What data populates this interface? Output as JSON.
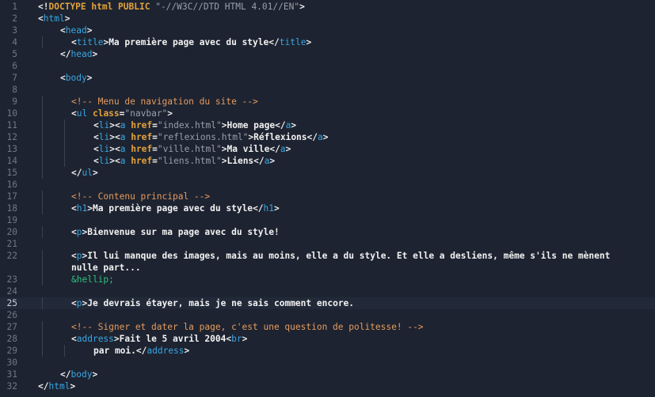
{
  "editor": {
    "current_line": 25,
    "lines": [
      {
        "n": "1",
        "indent": 0,
        "tokens": [
          [
            "punct",
            "<!"
          ],
          [
            "doctype",
            "DOCTYPE html PUBLIC "
          ],
          [
            "str",
            "\"-//W3C//DTD HTML 4.01//EN\""
          ],
          [
            "punct",
            ">"
          ]
        ]
      },
      {
        "n": "2",
        "indent": 0,
        "tokens": [
          [
            "punct",
            "<"
          ],
          [
            "tag",
            "html"
          ],
          [
            "punct",
            ">"
          ]
        ]
      },
      {
        "n": "3",
        "indent": 1,
        "tokens": [
          [
            "punct",
            "<"
          ],
          [
            "tag",
            "head"
          ],
          [
            "punct",
            ">"
          ]
        ]
      },
      {
        "n": "4",
        "indent": 2,
        "tokens": [
          [
            "punct",
            "<"
          ],
          [
            "tag",
            "title"
          ],
          [
            "punct",
            ">"
          ],
          [
            "text",
            "Ma première page avec du style"
          ],
          [
            "punct",
            "</"
          ],
          [
            "tag",
            "title"
          ],
          [
            "punct",
            ">"
          ]
        ]
      },
      {
        "n": "5",
        "indent": 1,
        "tokens": [
          [
            "punct",
            "</"
          ],
          [
            "tag",
            "head"
          ],
          [
            "punct",
            ">"
          ]
        ]
      },
      {
        "n": "6",
        "indent": 0,
        "tokens": []
      },
      {
        "n": "7",
        "indent": 1,
        "tokens": [
          [
            "punct",
            "<"
          ],
          [
            "tag",
            "body"
          ],
          [
            "punct",
            ">"
          ]
        ]
      },
      {
        "n": "8",
        "indent": 0,
        "tokens": []
      },
      {
        "n": "9",
        "indent": 2,
        "tokens": [
          [
            "comment",
            "<!-- Menu de navigation du site -->"
          ]
        ]
      },
      {
        "n": "10",
        "indent": 2,
        "tokens": [
          [
            "punct",
            "<"
          ],
          [
            "tag",
            "ul "
          ],
          [
            "attr",
            "class"
          ],
          [
            "punct",
            "="
          ],
          [
            "str",
            "\"navbar\""
          ],
          [
            "punct",
            ">"
          ]
        ]
      },
      {
        "n": "11",
        "indent": 3,
        "tokens": [
          [
            "punct",
            "<"
          ],
          [
            "tag",
            "li"
          ],
          [
            "punct",
            "><"
          ],
          [
            "tag",
            "a "
          ],
          [
            "attr",
            "href"
          ],
          [
            "punct",
            "="
          ],
          [
            "str",
            "\"index.html\""
          ],
          [
            "punct",
            ">"
          ],
          [
            "text",
            "Home page"
          ],
          [
            "punct",
            "</"
          ],
          [
            "tag",
            "a"
          ],
          [
            "punct",
            ">"
          ]
        ]
      },
      {
        "n": "12",
        "indent": 3,
        "tokens": [
          [
            "punct",
            "<"
          ],
          [
            "tag",
            "li"
          ],
          [
            "punct",
            "><"
          ],
          [
            "tag",
            "a "
          ],
          [
            "attr",
            "href"
          ],
          [
            "punct",
            "="
          ],
          [
            "str",
            "\"reflexions.html\""
          ],
          [
            "punct",
            ">"
          ],
          [
            "text",
            "Réflexions"
          ],
          [
            "punct",
            "</"
          ],
          [
            "tag",
            "a"
          ],
          [
            "punct",
            ">"
          ]
        ]
      },
      {
        "n": "13",
        "indent": 3,
        "tokens": [
          [
            "punct",
            "<"
          ],
          [
            "tag",
            "li"
          ],
          [
            "punct",
            "><"
          ],
          [
            "tag",
            "a "
          ],
          [
            "attr",
            "href"
          ],
          [
            "punct",
            "="
          ],
          [
            "str",
            "\"ville.html\""
          ],
          [
            "punct",
            ">"
          ],
          [
            "text",
            "Ma ville"
          ],
          [
            "punct",
            "</"
          ],
          [
            "tag",
            "a"
          ],
          [
            "punct",
            ">"
          ]
        ]
      },
      {
        "n": "14",
        "indent": 3,
        "tokens": [
          [
            "punct",
            "<"
          ],
          [
            "tag",
            "li"
          ],
          [
            "punct",
            "><"
          ],
          [
            "tag",
            "a "
          ],
          [
            "attr",
            "href"
          ],
          [
            "punct",
            "="
          ],
          [
            "str",
            "\"liens.html\""
          ],
          [
            "punct",
            ">"
          ],
          [
            "text",
            "Liens"
          ],
          [
            "punct",
            "</"
          ],
          [
            "tag",
            "a"
          ],
          [
            "punct",
            ">"
          ]
        ]
      },
      {
        "n": "15",
        "indent": 2,
        "tokens": [
          [
            "punct",
            "</"
          ],
          [
            "tag",
            "ul"
          ],
          [
            "punct",
            ">"
          ]
        ]
      },
      {
        "n": "16",
        "indent": 0,
        "tokens": []
      },
      {
        "n": "17",
        "indent": 2,
        "tokens": [
          [
            "comment",
            "<!-- Contenu principal -->"
          ]
        ]
      },
      {
        "n": "18",
        "indent": 2,
        "tokens": [
          [
            "punct",
            "<"
          ],
          [
            "tag",
            "h1"
          ],
          [
            "punct",
            ">"
          ],
          [
            "text",
            "Ma première page avec du style"
          ],
          [
            "punct",
            "</"
          ],
          [
            "tag",
            "h1"
          ],
          [
            "punct",
            ">"
          ]
        ]
      },
      {
        "n": "19",
        "indent": 0,
        "tokens": []
      },
      {
        "n": "20",
        "indent": 2,
        "tokens": [
          [
            "punct",
            "<"
          ],
          [
            "tag",
            "p"
          ],
          [
            "punct",
            ">"
          ],
          [
            "text",
            "Bienvenue sur ma page avec du style!"
          ]
        ]
      },
      {
        "n": "21",
        "indent": 0,
        "tokens": []
      },
      {
        "n": "22",
        "indent": 2,
        "tokens": [
          [
            "punct",
            "<"
          ],
          [
            "tag",
            "p"
          ],
          [
            "punct",
            ">"
          ],
          [
            "text",
            "Il lui manque des images, mais au moins, elle a du style. Et elle a desliens, même s'ils ne mènent"
          ]
        ]
      },
      {
        "n": "",
        "indent": 2,
        "tokens": [
          [
            "text",
            "nulle part..."
          ]
        ]
      },
      {
        "n": "23",
        "indent": 2,
        "tokens": [
          [
            "entity",
            "&hellip;"
          ]
        ]
      },
      {
        "n": "24",
        "indent": 0,
        "tokens": []
      },
      {
        "n": "25",
        "indent": 2,
        "tokens": [
          [
            "punct",
            "<"
          ],
          [
            "tag",
            "p"
          ],
          [
            "punct",
            ">"
          ],
          [
            "text",
            "Je devrais étayer, mais je ne sais comment encore."
          ]
        ]
      },
      {
        "n": "26",
        "indent": 0,
        "tokens": []
      },
      {
        "n": "27",
        "indent": 2,
        "tokens": [
          [
            "comment",
            "<!-- Signer et dater la page, c'est une question de politesse! -->"
          ]
        ]
      },
      {
        "n": "28",
        "indent": 2,
        "tokens": [
          [
            "punct",
            "<"
          ],
          [
            "tag",
            "address"
          ],
          [
            "punct",
            ">"
          ],
          [
            "text",
            "Fait le 5 avril 2004"
          ],
          [
            "punct",
            "<"
          ],
          [
            "tag",
            "br"
          ],
          [
            "punct",
            ">"
          ]
        ]
      },
      {
        "n": "29",
        "indent": 3,
        "tokens": [
          [
            "text",
            "par moi."
          ],
          [
            "punct",
            "</"
          ],
          [
            "tag",
            "address"
          ],
          [
            "punct",
            ">"
          ]
        ]
      },
      {
        "n": "30",
        "indent": 0,
        "tokens": []
      },
      {
        "n": "31",
        "indent": 1,
        "tokens": [
          [
            "punct",
            "</"
          ],
          [
            "tag",
            "body"
          ],
          [
            "punct",
            ">"
          ]
        ]
      },
      {
        "n": "32",
        "indent": 0,
        "tokens": [
          [
            "punct",
            "</"
          ],
          [
            "tag",
            "html"
          ],
          [
            "punct",
            ">"
          ]
        ]
      }
    ]
  }
}
